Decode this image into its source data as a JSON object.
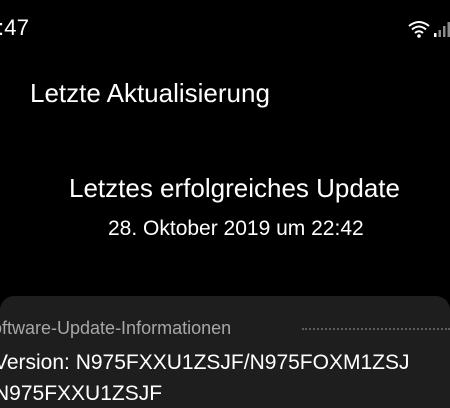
{
  "status_bar": {
    "time": ":47",
    "wifi_icon": "wifi-icon",
    "signal_icon": "signal-icon"
  },
  "page": {
    "title": "Letzte Aktualisierung"
  },
  "last_update": {
    "title": "Letztes erfolgreiches Update",
    "date": "28. Oktober 2019 um 22:42"
  },
  "software_info": {
    "header": "oftware-Update-Informationen",
    "version_line": "Version: N975FXXU1ZSJF/N975FOXM1ZSJ",
    "version_line_2": "N975FXXU1ZSJF"
  },
  "colors": {
    "background": "#000000",
    "panel": "#1e1e1e",
    "text": "#ffffff",
    "muted_text": "#a7a7a7"
  }
}
